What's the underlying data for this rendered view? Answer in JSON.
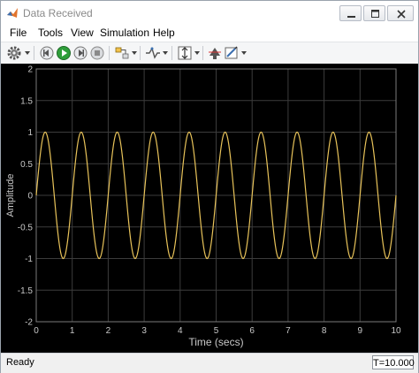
{
  "window": {
    "title": "Data Received"
  },
  "menu": {
    "items": [
      "File",
      "Tools",
      "View",
      "Simulation",
      "Help"
    ]
  },
  "toolbar": {
    "icons": [
      "gear-icon",
      "step-back-icon",
      "run-icon",
      "step-forward-icon",
      "stop-icon",
      "highlight-icon",
      "signal-icon",
      "scale-axes-icon",
      "cursor-icon",
      "style-icon"
    ]
  },
  "status": {
    "text": "Ready",
    "time": "T=10.000"
  },
  "colors": {
    "plot_background": "#000000",
    "grid": "#3c3c3c",
    "axis_text": "#c8c8c8",
    "signal": "#e8c35a"
  },
  "chart_data": {
    "type": "line",
    "title": "",
    "xlabel": "Time (secs)",
    "ylabel": "Amplitude",
    "xlim": [
      0,
      10
    ],
    "ylim": [
      -2,
      2
    ],
    "xticks": [
      "0",
      "1",
      "2",
      "3",
      "4",
      "5",
      "6",
      "7",
      "8",
      "9",
      "10"
    ],
    "yticks": [
      "2",
      "1.5",
      "1",
      "0.5",
      "0",
      "-0.5",
      "-1",
      "-1.5",
      "-2"
    ],
    "grid": true,
    "series": [
      {
        "name": "",
        "function": "sine",
        "amplitude": 1,
        "frequency_hz": 1,
        "phase": 0,
        "x_start": 0,
        "x_end": 10
      }
    ]
  }
}
